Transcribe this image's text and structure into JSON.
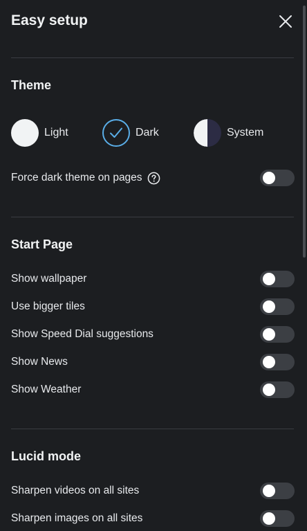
{
  "header": {
    "title": "Easy setup",
    "close_icon": "close-icon"
  },
  "theme": {
    "title": "Theme",
    "options": [
      {
        "label": "Light",
        "icon": "light-theme-circle-icon",
        "selected": false
      },
      {
        "label": "Dark",
        "icon": "dark-theme-check-icon",
        "selected": true
      },
      {
        "label": "System",
        "icon": "system-theme-half-icon",
        "selected": false
      }
    ],
    "force_dark": {
      "label": "Force dark theme on pages",
      "help_icon": "help-circle-icon",
      "enabled": false
    }
  },
  "start_page": {
    "title": "Start Page",
    "items": [
      {
        "label": "Show wallpaper",
        "enabled": false
      },
      {
        "label": "Use bigger tiles",
        "enabled": false
      },
      {
        "label": "Show Speed Dial suggestions",
        "enabled": false
      },
      {
        "label": "Show News",
        "enabled": false
      },
      {
        "label": "Show Weather",
        "enabled": false
      }
    ]
  },
  "lucid_mode": {
    "title": "Lucid mode",
    "items": [
      {
        "label": "Sharpen videos on all sites",
        "enabled": false
      },
      {
        "label": "Sharpen images on all sites",
        "enabled": false
      }
    ]
  },
  "colors": {
    "background": "#1c1e21",
    "toggle_off": "#3c3f44",
    "accent": "#5aaee8",
    "divider": "#3a3d42"
  }
}
